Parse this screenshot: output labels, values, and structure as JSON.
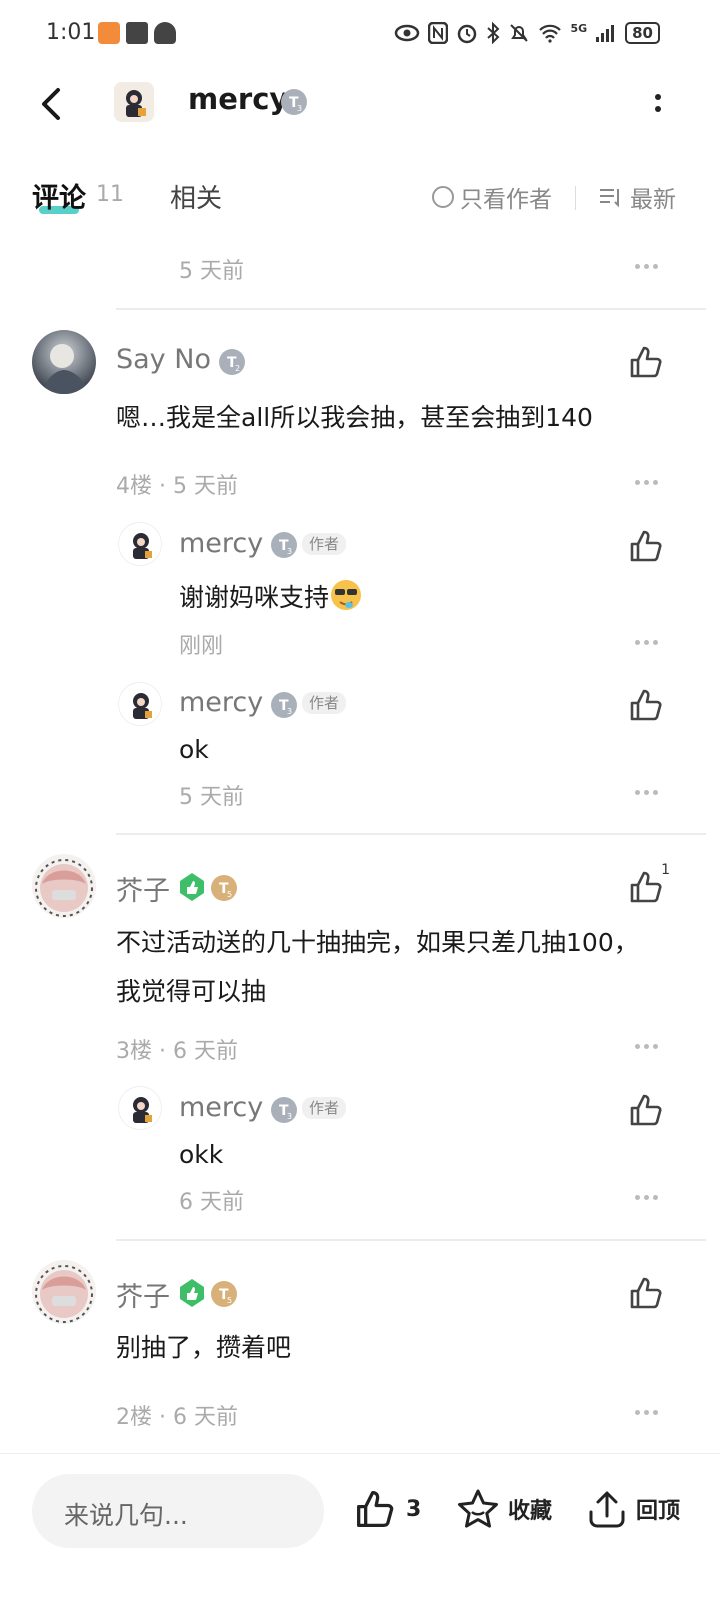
{
  "status_bar": {
    "time": "1:01",
    "network": "5G",
    "battery": "80"
  },
  "header": {
    "username": "mercy",
    "level_badge": "3"
  },
  "tabs": {
    "comments_label": "评论",
    "comments_count": "11",
    "related_label": "相关",
    "author_only_label": "只看作者",
    "sort_label": "最新"
  },
  "comments": [
    {
      "meta": "5 天前"
    },
    {
      "username": "Say No",
      "level": "2",
      "text": "嗯…我是全all所以我会抽，甚至会抽到140",
      "meta": "4楼 · 5 天前",
      "replies": [
        {
          "username": "mercy",
          "level": "3",
          "tag": "作者",
          "text": "谢谢妈咪支持",
          "meta": "刚刚"
        },
        {
          "username": "mercy",
          "level": "3",
          "tag": "作者",
          "text": "ok",
          "meta": "5 天前"
        }
      ]
    },
    {
      "username": "芥子",
      "level": "5",
      "text_line1": "不过活动送的几十抽抽完，如果只差几抽100，",
      "text_line2": "我觉得可以抽",
      "meta": "3楼 · 6 天前",
      "like_count": "1",
      "replies": [
        {
          "username": "mercy",
          "level": "3",
          "tag": "作者",
          "text": "okk",
          "meta": "6 天前"
        }
      ]
    },
    {
      "username": "芥子",
      "level": "5",
      "text": "别抽了，攒着吧",
      "meta": "2楼 · 6 天前"
    }
  ],
  "bottom_bar": {
    "input_placeholder": "来说几句...",
    "like_count": "3",
    "favorite_label": "收藏",
    "top_label": "回顶"
  },
  "colors": {
    "tab_underline": "#3bc7c0",
    "level_gray": "#a9b0ba",
    "level_gold": "#d8b07a",
    "shield_green": "#3fbe6a"
  }
}
